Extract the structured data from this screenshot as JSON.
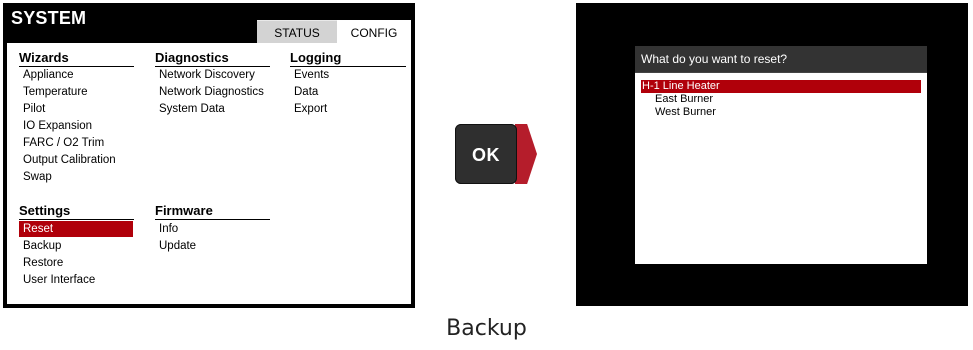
{
  "left_screen": {
    "title": "SYSTEM",
    "tabs": [
      {
        "label": "STATUS",
        "active": false
      },
      {
        "label": "CONFIG",
        "active": true
      }
    ],
    "sections": {
      "wizards": {
        "heading": "Wizards",
        "items": [
          "Appliance",
          "Temperature",
          "Pilot",
          "IO Expansion",
          "FARC / O2 Trim",
          "Output Calibration",
          "Swap"
        ]
      },
      "diagnostics": {
        "heading": "Diagnostics",
        "items": [
          "Network Discovery",
          "Network Diagnostics",
          "System Data"
        ]
      },
      "logging": {
        "heading": "Logging",
        "items": [
          "Events",
          "Data",
          "Export"
        ]
      },
      "settings": {
        "heading": "Settings",
        "items": [
          "Reset",
          "Backup",
          "Restore",
          "User Interface"
        ],
        "selected": "Reset"
      },
      "firmware": {
        "heading": "Firmware",
        "items": [
          "Info",
          "Update"
        ]
      }
    }
  },
  "ok_button": {
    "label": "OK"
  },
  "right_screen": {
    "dialog_title": "What do you want to reset?",
    "options": [
      "H-1 Line Heater",
      "East Burner",
      "West Burner"
    ],
    "selected": "H-1 Line Heater"
  },
  "caption": "Backup",
  "colors": {
    "highlight": "#b0000a",
    "arrow": "#b51d2b",
    "screen_bg": "#000000",
    "tab_inactive": "#d3d3d3",
    "dialog_header": "#333333"
  }
}
